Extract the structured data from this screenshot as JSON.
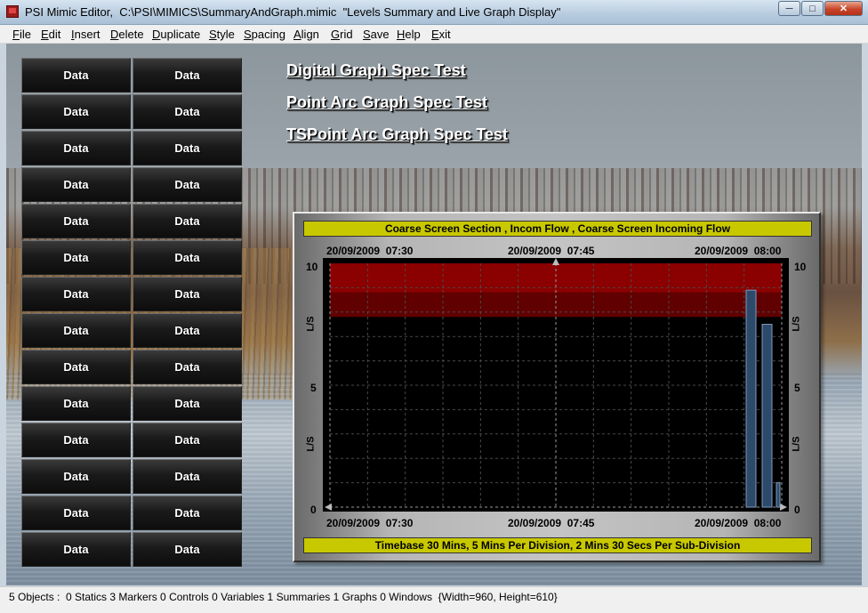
{
  "window": {
    "title": "PSI Mimic Editor,  C:\\PSI\\MIMICS\\SummaryAndGraph.mimic  \"Levels Summary and Live Graph Display\"",
    "minimize": "─",
    "maximize": "□",
    "close": "✕"
  },
  "menu": [
    "File",
    "Edit",
    "Insert",
    "Delete",
    "Duplicate",
    "Style",
    "Spacing",
    "Align",
    "Grid",
    "Save",
    "Help",
    "Exit"
  ],
  "data_button_label": "Data",
  "links": [
    "Digital Graph Spec Test",
    "Point Arc Graph Spec Test",
    "TSPoint Arc Graph Spec Test"
  ],
  "graph": {
    "title": "Coarse Screen Section , Incom Flow , Coarse Screen Incoming Flow",
    "footer": "Timebase 30 Mins,  5 Mins Per Division,  2 Mins 30 Secs Per Sub-Division",
    "time_labels_top": [
      "20/09/2009  07:30",
      "20/09/2009  07:45",
      "20/09/2009  08:00"
    ],
    "time_labels_bottom": [
      "20/09/2009  07:30",
      "20/09/2009  07:45",
      "20/09/2009  08:00"
    ],
    "y_ticks": [
      "10",
      "5",
      "0"
    ],
    "unit": "L/S",
    "colors": {
      "alarm_high": "#8b0000",
      "alarm_mid": "#600000",
      "plot_bg": "#000000",
      "bar": "#3a5a80",
      "header_bar": "#c8c800"
    }
  },
  "chart_data": {
    "type": "bar",
    "title": "Coarse Screen Section , Incom Flow , Coarse Screen Incoming Flow",
    "xlabel": "Timebase 30 Mins,  5 Mins Per Division,  2 Mins 30 Secs Per Sub-Division",
    "ylabel": "L/S",
    "ylim": [
      0,
      10
    ],
    "xlim": [
      "20/09/2009 07:30",
      "20/09/2009 08:00"
    ],
    "x": [
      "20/09/2009 07:58",
      "20/09/2009 07:59",
      "20/09/2009 08:00"
    ],
    "values": [
      8.9,
      7.5,
      1.0
    ],
    "alarm_bands": [
      {
        "from": 8.8,
        "to": 10,
        "color": "#8b0000"
      },
      {
        "from": 7.8,
        "to": 8.8,
        "color": "#600000"
      }
    ],
    "grid": true
  },
  "status": "5 Objects :  0 Statics 3 Markers 0 Controls 0 Variables 1 Summaries 1 Graphs 0 Windows  {Width=960, Height=610}"
}
